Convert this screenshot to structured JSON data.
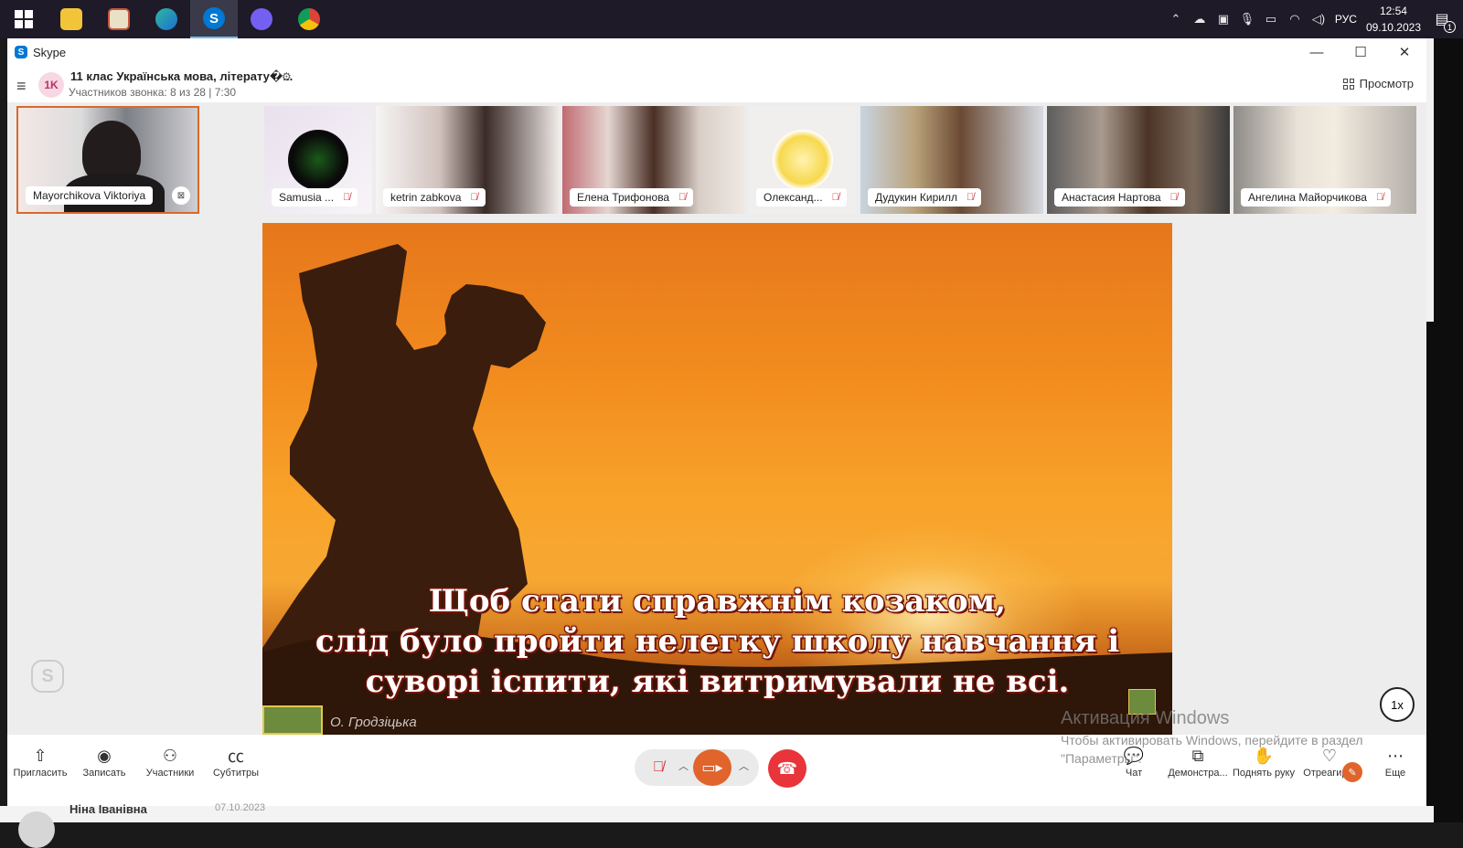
{
  "taskbar": {
    "apps": [
      {
        "name": "windows-start"
      },
      {
        "name": "file-explorer"
      },
      {
        "name": "app-2"
      },
      {
        "name": "edge"
      },
      {
        "name": "skype",
        "active": true
      },
      {
        "name": "viber"
      },
      {
        "name": "chrome"
      }
    ],
    "tray": {
      "lang": "РУС",
      "time": "12:54",
      "date": "09.10.2023",
      "notifications": "1"
    }
  },
  "window": {
    "title": "Skype"
  },
  "call": {
    "avatar": "1K",
    "title": "11 клас Українська мова, літерату�...",
    "subtitle": "Участников звонка: 8 из 28 | 7:30",
    "view_label": "Просмотр"
  },
  "participants": [
    {
      "name": "Mayorchikova Viktoriya"
    },
    {
      "name": "Samusia ..."
    },
    {
      "name": "ketrin zabkova"
    },
    {
      "name": "Елена Трифонова"
    },
    {
      "name": "Олександ..."
    },
    {
      "name": "Дудукин Кирилл"
    },
    {
      "name": "Анастасия Нартова"
    },
    {
      "name": "Ангелина Майорчикова"
    }
  ],
  "main_video": {
    "subtitle_lines": [
      "Щоб стати справжнім козаком,",
      "слід було пройти нелегку школу навчання і",
      "суворі іспити, які витримували не всі."
    ],
    "credit": "О. Гродзіцька",
    "speed": "1x"
  },
  "activation": {
    "title": "Активация Windows",
    "line1": "Чтобы активировать Windows, перейдите в раздел",
    "line2": "\"Параметры\"."
  },
  "bottom_bar": {
    "invite": "Пригласить",
    "record": "Записать",
    "participants": "Участники",
    "subtitles": "Субтитры",
    "chat": "Чат",
    "share": "Демонстра...",
    "raise_hand": "Поднять руку",
    "react": "Отреагир...",
    "more": "Еще"
  },
  "under_window": {
    "name": "Ніна Іванівна",
    "date": "07.10.2023"
  }
}
